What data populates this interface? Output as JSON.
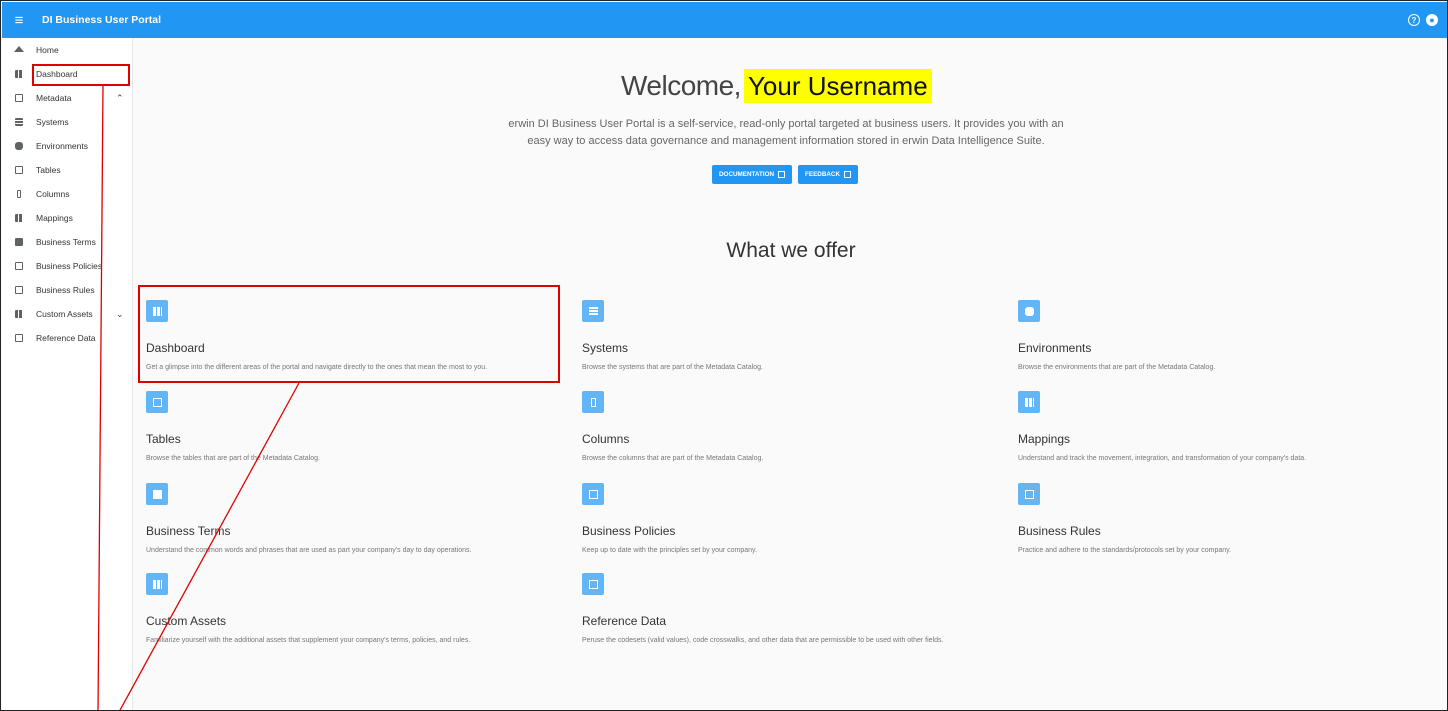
{
  "topbar": {
    "app_title": "DI Business User Portal",
    "icons": [
      "menu-icon",
      "help-icon",
      "account-icon"
    ]
  },
  "sidebar": {
    "items": [
      {
        "label": "Home",
        "icon": "home-icon"
      },
      {
        "label": "Dashboard",
        "icon": "dashboard-icon"
      },
      {
        "label": "Metadata",
        "icon": "metadata-icon",
        "expanded": true
      },
      {
        "label": "Systems",
        "icon": "systems-icon"
      },
      {
        "label": "Environments",
        "icon": "environments-icon"
      },
      {
        "label": "Tables",
        "icon": "tables-icon"
      },
      {
        "label": "Columns",
        "icon": "columns-icon"
      },
      {
        "label": "Mappings",
        "icon": "mappings-icon"
      },
      {
        "label": "Business Terms",
        "icon": "business-terms-icon"
      },
      {
        "label": "Business Policies",
        "icon": "business-policies-icon"
      },
      {
        "label": "Business Rules",
        "icon": "business-rules-icon"
      },
      {
        "label": "Custom Assets",
        "icon": "custom-assets-icon",
        "expanded": false
      },
      {
        "label": "Reference Data",
        "icon": "reference-data-icon"
      }
    ]
  },
  "main": {
    "welcome_prefix": "Welcome,",
    "username": "Your Username",
    "intro_line1": "erwin DI Business User Portal is a self-service, read-only portal targeted at business users. It provides you with an",
    "intro_line2": "easy way to access data governance and management information stored in erwin Data Intelligence Suite.",
    "documentation_label": "DOCUMENTATION",
    "feedback_label": "FEEDBACK",
    "offer_heading": "What we offer",
    "cards": [
      {
        "title": "Dashboard",
        "desc": "Get a glimpse into the different areas of the portal and navigate directly to the ones that mean the most to you.",
        "icon": "dashboard-icon"
      },
      {
        "title": "Systems",
        "desc": "Browse the systems that are part of the Metadata Catalog.",
        "icon": "systems-icon"
      },
      {
        "title": "Environments",
        "desc": "Browse the environments that are part of the Metadata Catalog.",
        "icon": "environments-icon"
      },
      {
        "title": "Tables",
        "desc": "Browse the tables that are part of the Metadata Catalog.",
        "icon": "tables-icon"
      },
      {
        "title": "Columns",
        "desc": "Browse the columns that are part of the Metadata Catalog.",
        "icon": "columns-icon"
      },
      {
        "title": "Mappings",
        "desc": "Understand and track the movement, integration, and transformation of your company's data.",
        "icon": "mappings-icon"
      },
      {
        "title": "Business Terms",
        "desc": "Understand the common words and phrases that are used as part your company's day to day operations.",
        "icon": "business-terms-icon"
      },
      {
        "title": "Business Policies",
        "desc": "Keep up to date with the principles set by your company.",
        "icon": "business-policies-icon"
      },
      {
        "title": "Business Rules",
        "desc": "Practice and adhere to the standards/protocols set by your company.",
        "icon": "business-rules-icon"
      },
      {
        "title": "Custom Assets",
        "desc": "Familiarize yourself with the additional assets that supplement your company's terms, policies, and rules.",
        "icon": "custom-assets-icon"
      },
      {
        "title": "Reference Data",
        "desc": "Peruse the codesets (valid values), code crosswalks, and other data that are permissible to be used with other fields.",
        "icon": "reference-data-icon"
      }
    ]
  },
  "colors": {
    "primary": "#2196f3",
    "tile": "#64b5f6",
    "highlight": "#ffff00",
    "annotation": "#e00000"
  }
}
